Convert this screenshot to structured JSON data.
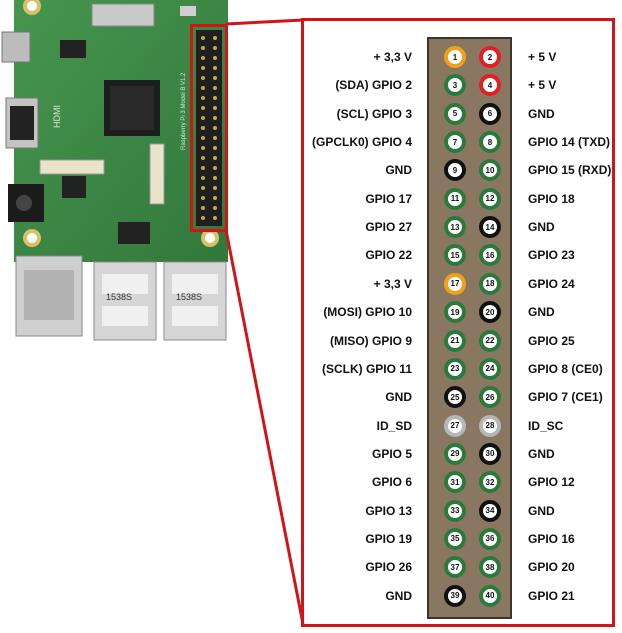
{
  "colors": {
    "gpio": "#2a7a3e",
    "power_3v3": "#f0a11b",
    "power_5v": "#e01f26",
    "ground": "#111111",
    "id_eeprom": "#b7b7b7",
    "header_body": "#8a7762",
    "callout": "#d01418"
  },
  "pins": [
    {
      "left": "+ 3,3 V",
      "left_num": "1",
      "left_type": "power_3v3",
      "right_num": "2",
      "right_type": "power_5v",
      "right": "+ 5 V"
    },
    {
      "left": "(SDA) GPIO 2",
      "left_num": "3",
      "left_type": "gpio",
      "right_num": "4",
      "right_type": "power_5v",
      "right": "+ 5 V"
    },
    {
      "left": "(SCL) GPIO 3",
      "left_num": "5",
      "left_type": "gpio",
      "right_num": "6",
      "right_type": "ground",
      "right": "GND"
    },
    {
      "left": "(GPCLK0) GPIO 4",
      "left_num": "7",
      "left_type": "gpio",
      "right_num": "8",
      "right_type": "gpio",
      "right": "GPIO 14 (TXD)"
    },
    {
      "left": "GND",
      "left_num": "9",
      "left_type": "ground",
      "right_num": "10",
      "right_type": "gpio",
      "right": "GPIO 15 (RXD)"
    },
    {
      "left": "GPIO 17",
      "left_num": "11",
      "left_type": "gpio",
      "right_num": "12",
      "right_type": "gpio",
      "right": "GPIO 18"
    },
    {
      "left": "GPIO 27",
      "left_num": "13",
      "left_type": "gpio",
      "right_num": "14",
      "right_type": "ground",
      "right": "GND"
    },
    {
      "left": "GPIO 22",
      "left_num": "15",
      "left_type": "gpio",
      "right_num": "16",
      "right_type": "gpio",
      "right": "GPIO 23"
    },
    {
      "left": "+ 3,3 V",
      "left_num": "17",
      "left_type": "power_3v3",
      "right_num": "18",
      "right_type": "gpio",
      "right": "GPIO 24"
    },
    {
      "left": "(MOSI) GPIO 10",
      "left_num": "19",
      "left_type": "gpio",
      "right_num": "20",
      "right_type": "ground",
      "right": "GND"
    },
    {
      "left": "(MISO) GPIO 9",
      "left_num": "21",
      "left_type": "gpio",
      "right_num": "22",
      "right_type": "gpio",
      "right": "GPIO 25"
    },
    {
      "left": "(SCLK) GPIO 11",
      "left_num": "23",
      "left_type": "gpio",
      "right_num": "24",
      "right_type": "gpio",
      "right": "GPIO 8 (CE0)"
    },
    {
      "left": "GND",
      "left_num": "25",
      "left_type": "ground",
      "right_num": "26",
      "right_type": "gpio",
      "right": "GPIO 7 (CE1)"
    },
    {
      "left": "ID_SD",
      "left_num": "27",
      "left_type": "id_eeprom",
      "right_num": "28",
      "right_type": "id_eeprom",
      "right": "ID_SC"
    },
    {
      "left": "GPIO 5",
      "left_num": "29",
      "left_type": "gpio",
      "right_num": "30",
      "right_type": "ground",
      "right": "GND"
    },
    {
      "left": "GPIO 6",
      "left_num": "31",
      "left_type": "gpio",
      "right_num": "32",
      "right_type": "gpio",
      "right": "GPIO 12"
    },
    {
      "left": "GPIO 13",
      "left_num": "33",
      "left_type": "gpio",
      "right_num": "34",
      "right_type": "ground",
      "right": "GND"
    },
    {
      "left": "GPIO 19",
      "left_num": "35",
      "left_type": "gpio",
      "right_num": "36",
      "right_type": "gpio",
      "right": "GPIO 16"
    },
    {
      "left": "GPIO 26",
      "left_num": "37",
      "left_type": "gpio",
      "right_num": "38",
      "right_type": "gpio",
      "right": "GPIO 20"
    },
    {
      "left": "GND",
      "left_num": "39",
      "left_type": "ground",
      "right_num": "40",
      "right_type": "gpio",
      "right": "GPIO 21"
    }
  ],
  "board": {
    "silkscreen": "Raspberry Pi 3 Model B V1.2",
    "hdmi_label": "HDMI",
    "usb_chip_labels": [
      "1538S",
      "1538S"
    ]
  }
}
